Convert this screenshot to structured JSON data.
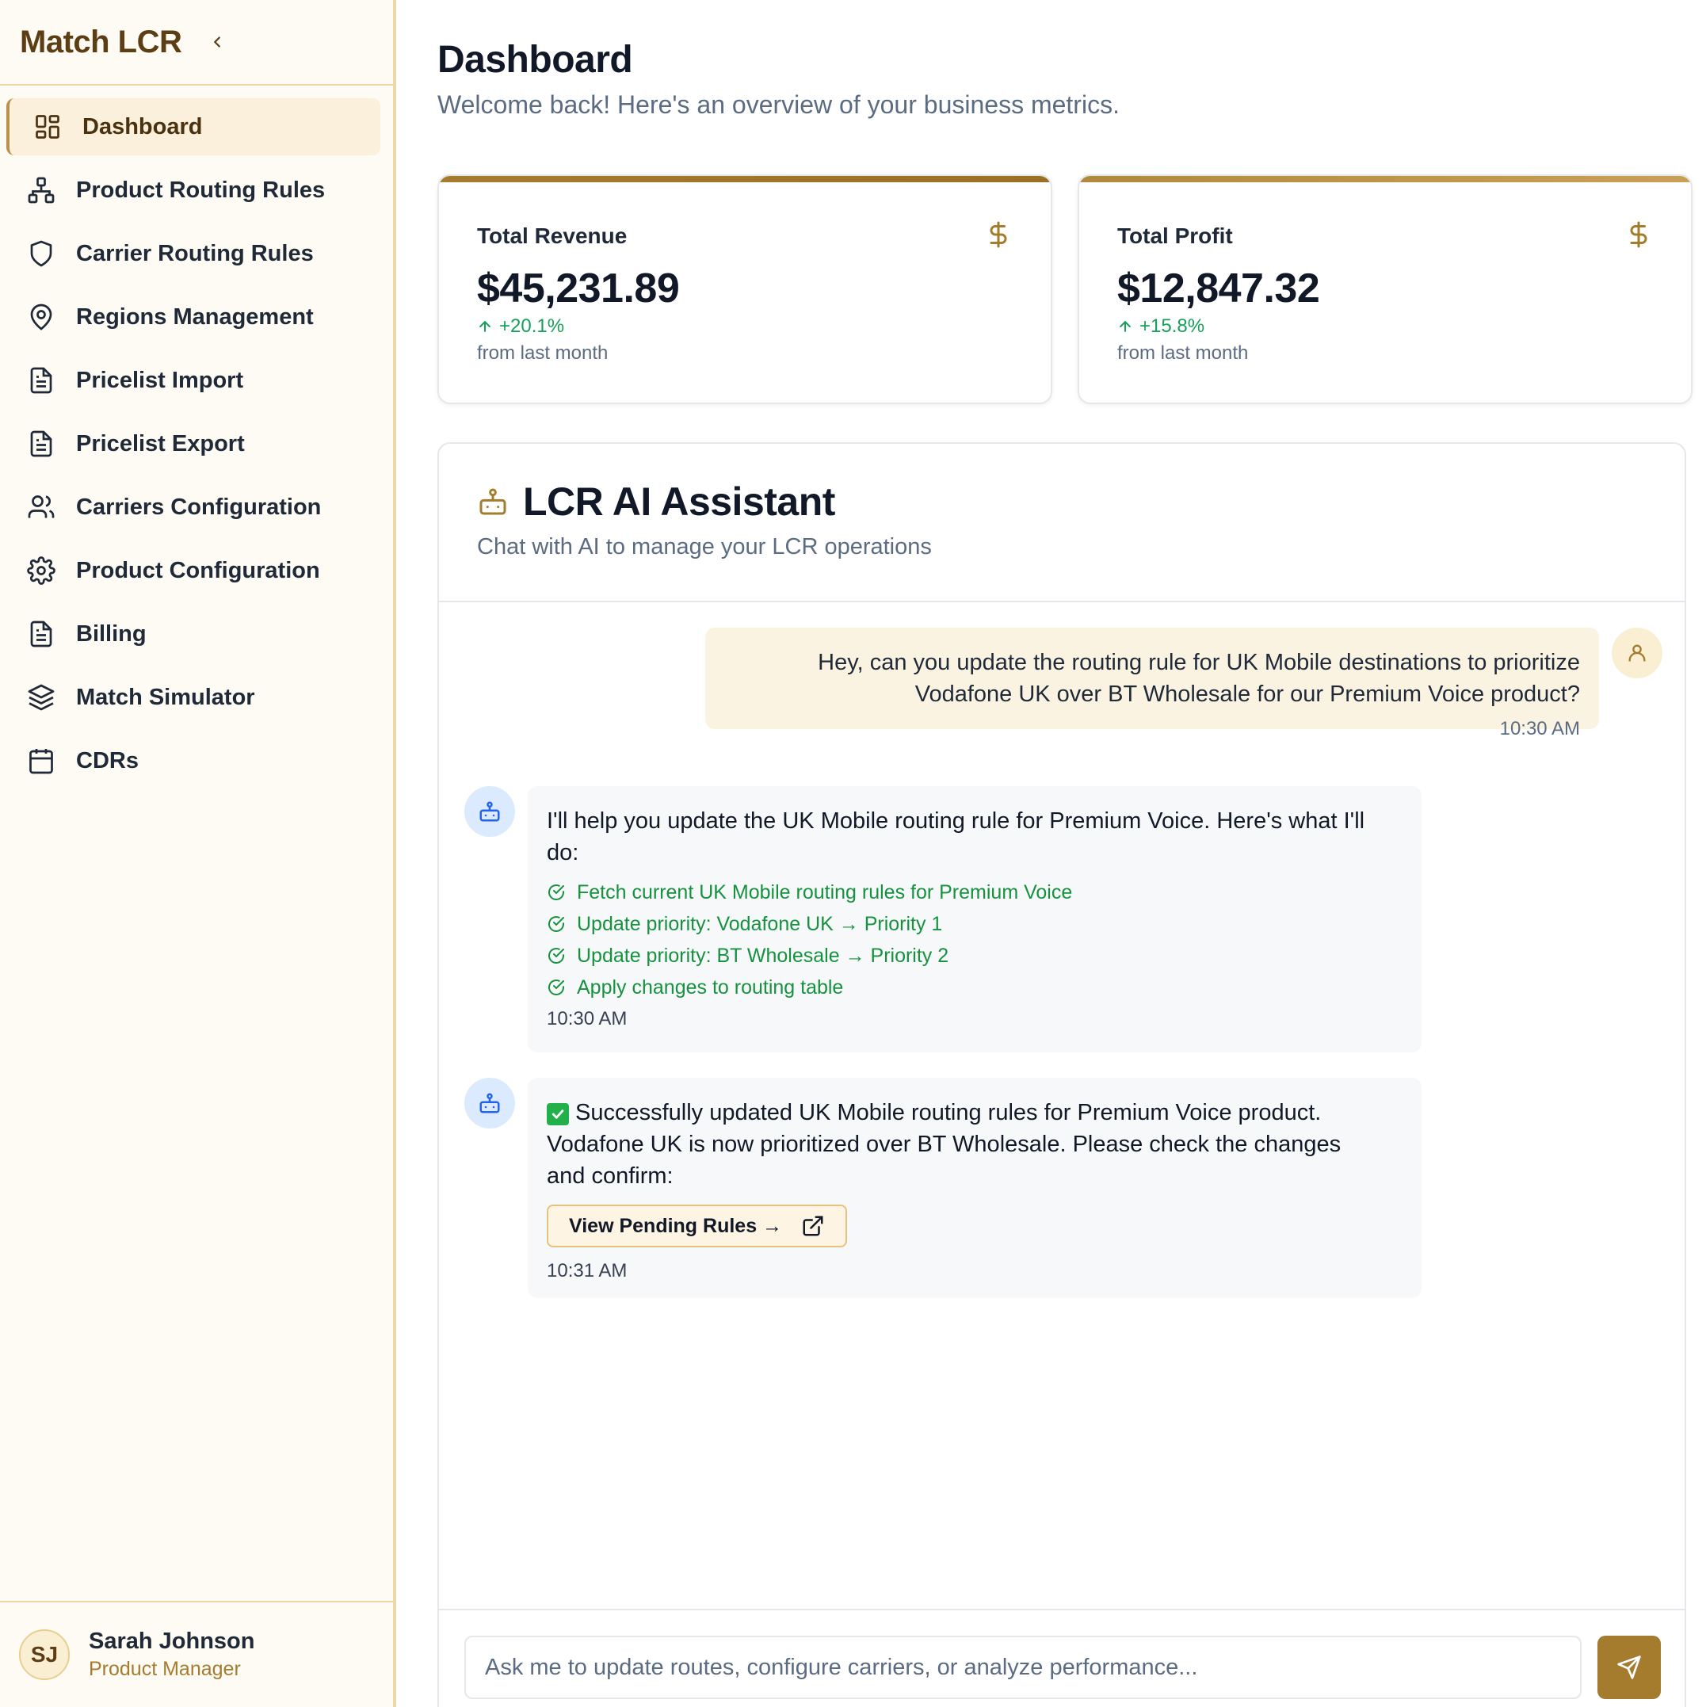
{
  "sidebar": {
    "brand": "Match LCR",
    "items": [
      {
        "label": "Dashboard",
        "icon": "dashboard-icon",
        "active": true
      },
      {
        "label": "Product Routing Rules",
        "icon": "network-icon"
      },
      {
        "label": "Carrier Routing Rules",
        "icon": "shield-icon"
      },
      {
        "label": "Regions Management",
        "icon": "map-pin-icon"
      },
      {
        "label": "Pricelist Import",
        "icon": "file-text-icon"
      },
      {
        "label": "Pricelist Export",
        "icon": "file-text-icon"
      },
      {
        "label": "Carriers Configuration",
        "icon": "users-icon"
      },
      {
        "label": "Product Configuration",
        "icon": "gear-icon"
      },
      {
        "label": "Billing",
        "icon": "file-text-icon"
      },
      {
        "label": "Match Simulator",
        "icon": "layers-icon"
      },
      {
        "label": "CDRs",
        "icon": "calendar-icon"
      }
    ],
    "user": {
      "initials": "SJ",
      "name": "Sarah Johnson",
      "role": "Product Manager"
    }
  },
  "header": {
    "title": "Dashboard",
    "subtitle": "Welcome back! Here's an overview of your business metrics."
  },
  "stats": [
    {
      "label": "Total Revenue",
      "value": "$45,231.89",
      "change": "+20.1%",
      "note": "from last month",
      "icon": "dollar-icon"
    },
    {
      "label": "Total Profit",
      "value": "$12,847.32",
      "change": "+15.8%",
      "note": "from last month",
      "icon": "dollar-icon"
    }
  ],
  "chat": {
    "title": "LCR AI Assistant",
    "subtitle": "Chat with AI to manage your LCR operations",
    "messages": [
      {
        "from": "user",
        "line1": "Hey, can you update the routing rule for UK Mobile destinations to prioritize",
        "line2": "Vodafone UK over BT Wholesale for our Premium Voice product?",
        "time": "10:30 AM"
      },
      {
        "from": "bot",
        "line1": "I'll help you update the UK Mobile routing rule for Premium Voice. Here's what I'll",
        "line2": "do:",
        "steps": [
          "Fetch current UK Mobile routing rules for Premium Voice",
          "Update priority: Vodafone UK → Priority 1",
          "Update priority: BT Wholesale → Priority 2",
          "Apply changes to routing table"
        ],
        "time": "10:30 AM"
      },
      {
        "from": "bot",
        "line1": "Successfully updated UK Mobile routing rules for Premium Voice product.",
        "line2": "Vodafone UK is now prioritized over BT Wholesale. Please check the changes",
        "line3": "and confirm:",
        "button": "View Pending Rules →",
        "time": "10:31 AM"
      }
    ],
    "input_placeholder": "Ask me to update routes, configure carriers, or analyze performance..."
  },
  "colors": {
    "accent": "#a57c2e",
    "brand": "#5c3d14",
    "success": "#16a05a",
    "sidebar_bg": "#fdfbf4"
  }
}
